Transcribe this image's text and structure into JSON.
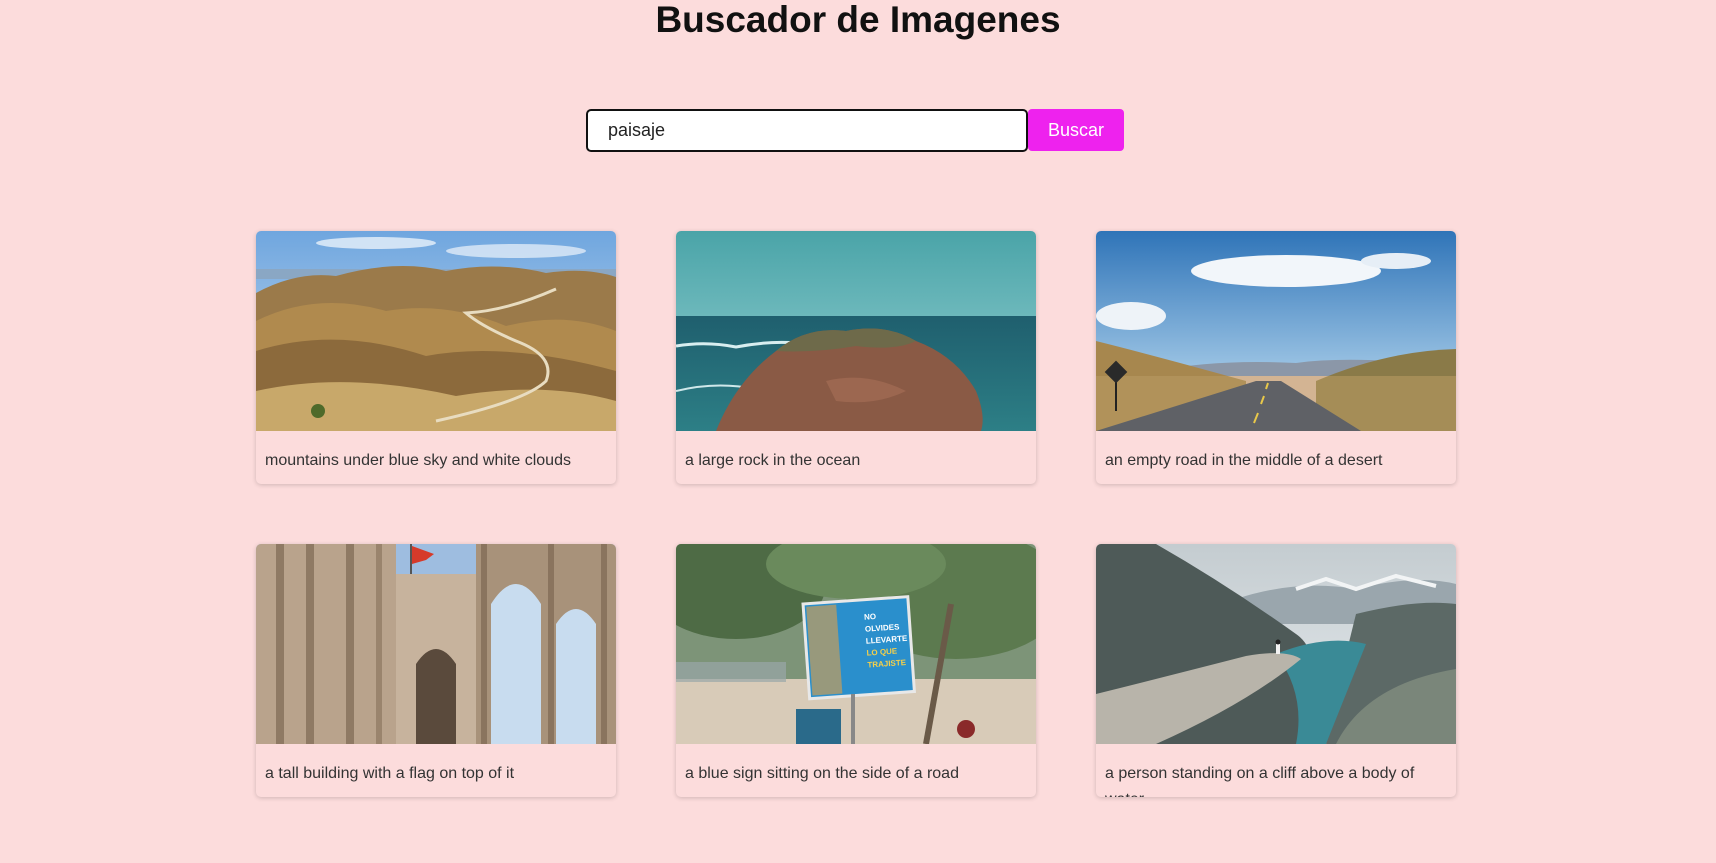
{
  "page": {
    "title": "Buscador de Imagenes"
  },
  "search": {
    "value": "paisaje",
    "button_label": "Buscar"
  },
  "results": [
    {
      "caption": "mountains under blue sky and white clouds",
      "scene": "mountains"
    },
    {
      "caption": "a large rock in the ocean",
      "scene": "ocean-rock"
    },
    {
      "caption": "an empty road in the middle of a desert",
      "scene": "desert-road"
    },
    {
      "caption": "a tall building with a flag on top of it",
      "scene": "gothic-ruins"
    },
    {
      "caption": "a blue sign sitting on the side of a road",
      "scene": "blue-sign"
    },
    {
      "caption": "a person standing on a cliff above a body of water",
      "scene": "cliff-fjord"
    }
  ],
  "sign_text": [
    "NO",
    "OLVIDES",
    "LLEVARTE",
    "LO QUE",
    "TRAJISTE"
  ],
  "colors": {
    "background": "#fcdcdc",
    "accent": "#ee22ee"
  }
}
